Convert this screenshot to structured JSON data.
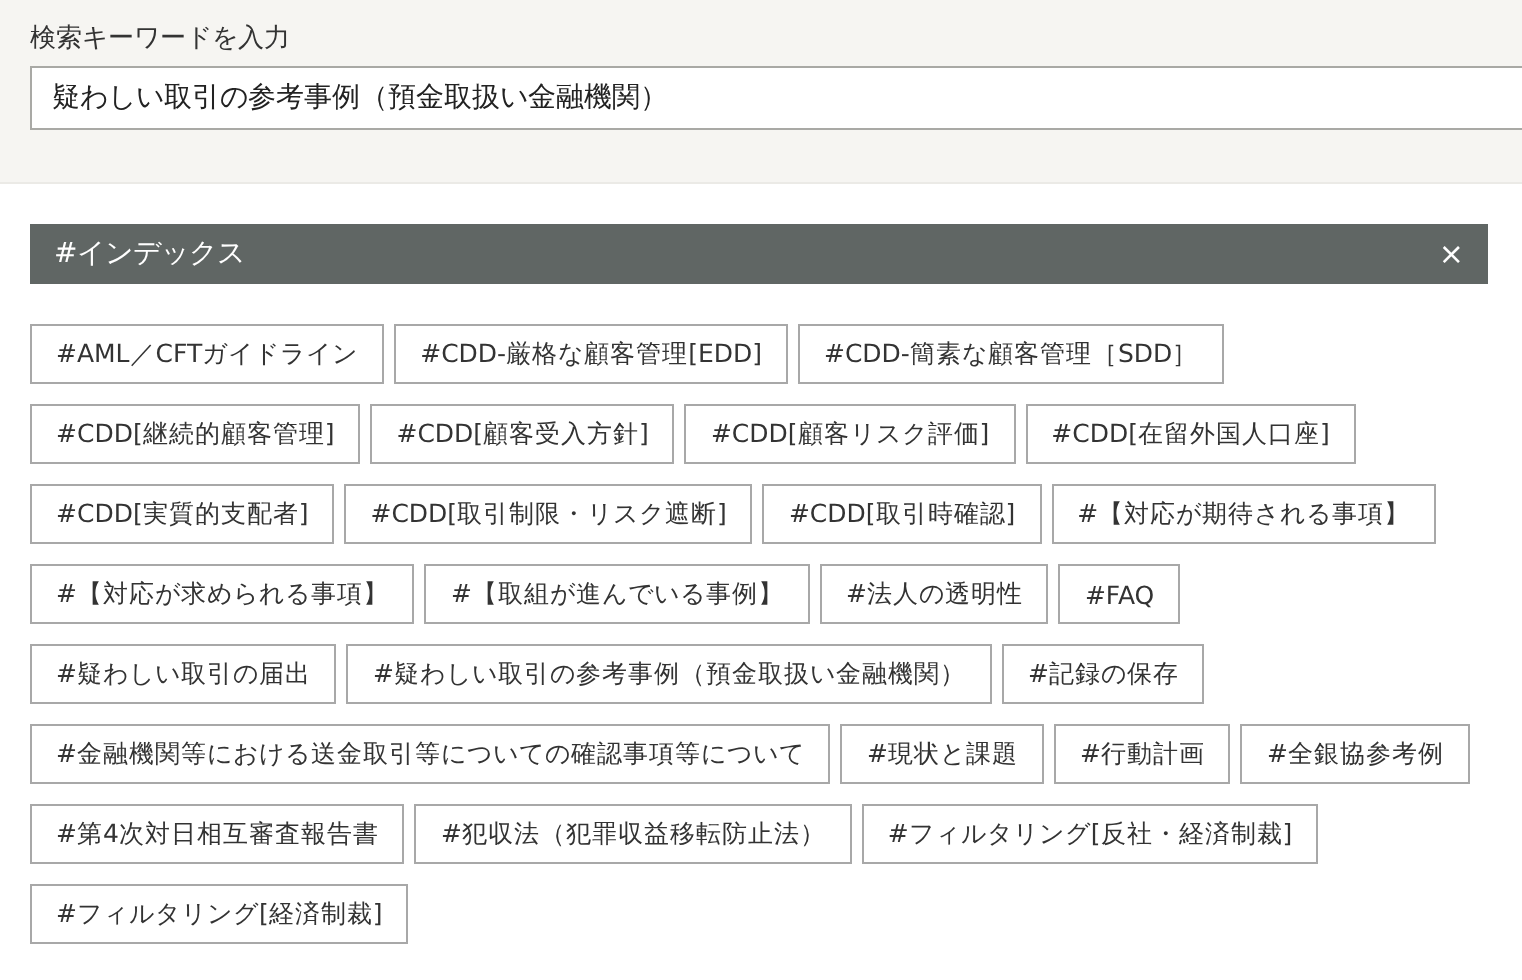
{
  "search": {
    "label": "検索キーワードを入力",
    "value": "疑わしい取引の参考事例（預金取扱い金融機関）"
  },
  "index_panel": {
    "title": "#インデックス",
    "close": "×",
    "tags": [
      {
        "label": "#AML／CFTガイドライン",
        "selected": false
      },
      {
        "label": "#CDD-厳格な顧客管理[EDD]",
        "selected": false
      },
      {
        "label": "#CDD-簡素な顧客管理［SDD］",
        "selected": false
      },
      {
        "label": "#CDD[継続的顧客管理]",
        "selected": false
      },
      {
        "label": "#CDD[顧客受入方針]",
        "selected": false
      },
      {
        "label": "#CDD[顧客リスク評価]",
        "selected": false
      },
      {
        "label": "#CDD[在留外国人口座]",
        "selected": false
      },
      {
        "label": "#CDD[実質的支配者]",
        "selected": false
      },
      {
        "label": "#CDD[取引制限・リスク遮断]",
        "selected": false
      },
      {
        "label": "#CDD[取引時確認]",
        "selected": false
      },
      {
        "label": "#【対応が期待される事項】",
        "selected": false
      },
      {
        "label": "#【対応が求められる事項】",
        "selected": false
      },
      {
        "label": "#【取組が進んでいる事例】",
        "selected": false
      },
      {
        "label": "#法人の透明性",
        "selected": false
      },
      {
        "label": "#FAQ",
        "selected": false
      },
      {
        "label": "#疑わしい取引の届出",
        "selected": false
      },
      {
        "label": "#疑わしい取引の参考事例（預金取扱い金融機関）",
        "selected": false
      },
      {
        "label": "#記録の保存",
        "selected": false
      },
      {
        "label": "#金融機関等における送金取引等についての確認事項等について",
        "selected": false
      },
      {
        "label": "#現状と課題",
        "selected": false
      },
      {
        "label": "#行動計画",
        "selected": false
      },
      {
        "label": "#全銀協参考例",
        "selected": false
      },
      {
        "label": "#第4次対日相互審査報告書",
        "selected": false
      },
      {
        "label": "#犯収法（犯罪収益移転防止法）",
        "selected": false
      },
      {
        "label": "#フィルタリング[反社・経済制裁]",
        "selected": false
      },
      {
        "label": "#フィルタリング[経済制裁]",
        "selected": false
      }
    ]
  }
}
